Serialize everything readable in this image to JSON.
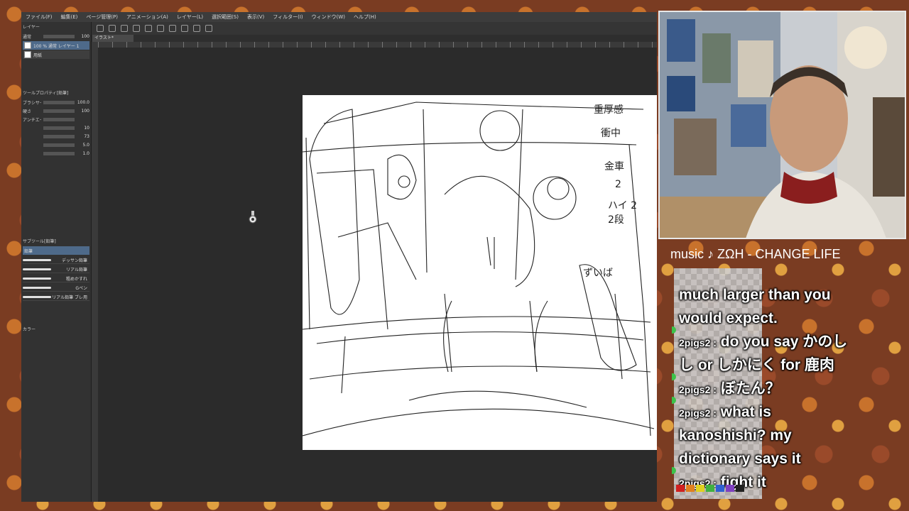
{
  "menu": [
    "ファイル(F)",
    "編集(E)",
    "ページ管理(P)",
    "アニメーション(A)",
    "レイヤー(L)",
    "選択範囲(S)",
    "表示(V)",
    "フィルター(I)",
    "ウィンドウ(W)",
    "ヘルプ(H)"
  ],
  "left_panel": {
    "title": "レイヤー",
    "blend_mode": "通常",
    "opacity": "100",
    "layers": [
      {
        "label": "100 % 通常 レイヤー 1"
      },
      {
        "label": "用紙"
      }
    ],
    "tool_property_title": "ツールプロパティ[鉛筆]",
    "props": [
      {
        "label": "ブラシサイズ",
        "value": "100.0"
      },
      {
        "label": "硬さ",
        "value": "100"
      },
      {
        "label": "アンチエイリアス",
        "value": ""
      },
      {
        "label": "",
        "value": "10"
      },
      {
        "label": "",
        "value": "73"
      },
      {
        "label": "",
        "value": "5.0"
      },
      {
        "label": "",
        "value": "1.0"
      }
    ],
    "brush_section_title": "サブツール[鉛筆]",
    "brush_tab": "鉛筆",
    "brushes": [
      "デッサン鉛筆",
      "リアル鉛筆",
      "粗めかすれ",
      "Gペン",
      "リアル鉛筆 ブレ用"
    ],
    "color_label": "カラー"
  },
  "canvas_tab": "イラスト*",
  "stream": {
    "music": "music ♪ ΖΩΗ - CHANGE   LIFE",
    "chat": [
      {
        "user": "",
        "text": "much larger than you"
      },
      {
        "user": "",
        "text": "would expect."
      },
      {
        "user": "2pigs2 :",
        "text": "do you say かのし"
      },
      {
        "user": "",
        "text": "し or しかにく for 鹿肉"
      },
      {
        "user": "2pigs2 :",
        "text": "ぼたん？"
      },
      {
        "user": "2pigs2 :",
        "text": "what is"
      },
      {
        "user": "",
        "text": "kanoshishi? my"
      },
      {
        "user": "",
        "text": "dictionary says it"
      },
      {
        "user": "2pigs2 :",
        "text": "fight it"
      }
    ]
  },
  "colors": {
    "accent": "#4e6a8a",
    "chat_text": "#ffffff",
    "chat_badge": "#3cc34a"
  }
}
